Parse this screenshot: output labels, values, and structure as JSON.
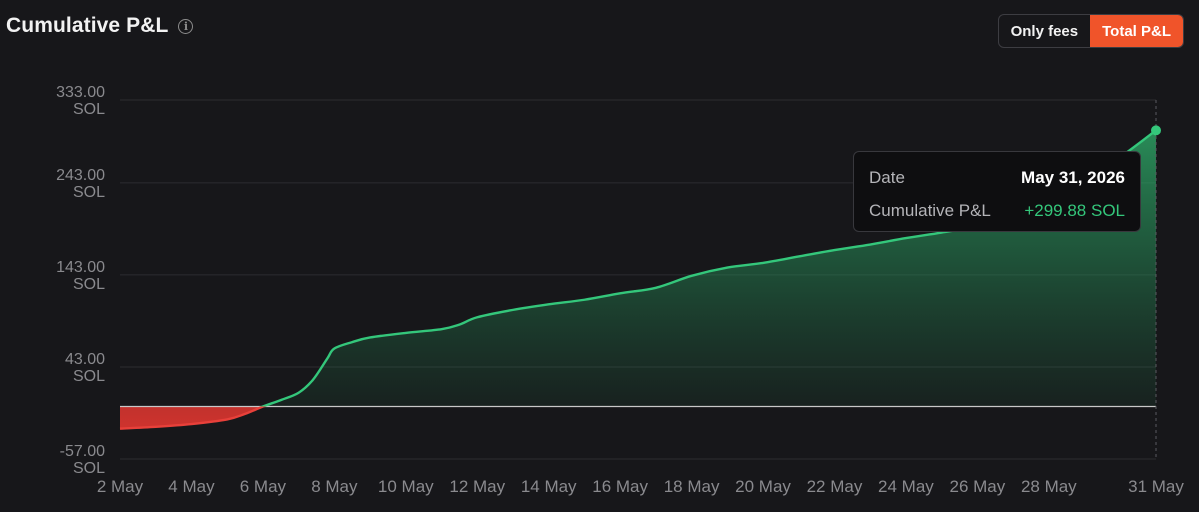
{
  "header": {
    "title": "Cumulative P&L",
    "info_icon": "info-circle-icon"
  },
  "toggle": {
    "options": [
      {
        "label": "Only fees",
        "active": false
      },
      {
        "label": "Total P&L",
        "active": true
      }
    ]
  },
  "tooltip": {
    "date_label": "Date",
    "date_value": "May 31, 2026",
    "pnl_label": "Cumulative P&L",
    "pnl_value": "+299.88 SOL"
  },
  "colors": {
    "positive": "#34c77b",
    "negative": "#e8403a",
    "accent": "#f0542a",
    "zero_line": "#c8c8c8"
  },
  "chart_data": {
    "type": "area",
    "ylim": [
      -57,
      333
    ],
    "y_ticks": [
      {
        "value": 333,
        "label": "333.00",
        "unit": "SOL"
      },
      {
        "value": 243,
        "label": "243.00",
        "unit": "SOL"
      },
      {
        "value": 143,
        "label": "143.00",
        "unit": "SOL"
      },
      {
        "value": 43,
        "label": "43.00",
        "unit": "SOL"
      },
      {
        "value": -57,
        "label": "-57.00",
        "unit": "SOL"
      }
    ],
    "x_ticks": [
      "2 May",
      "4 May",
      "6 May",
      "8 May",
      "10 May",
      "12 May",
      "14 May",
      "16 May",
      "18 May",
      "20 May",
      "22 May",
      "24 May",
      "26 May",
      "28 May",
      "31 May"
    ],
    "x_tick_days": [
      2,
      4,
      6,
      8,
      10,
      12,
      14,
      16,
      18,
      20,
      22,
      24,
      26,
      28,
      31
    ],
    "grid": true,
    "series": [
      {
        "x": [
          2,
          3,
          4,
          5,
          5.5,
          6,
          6.5,
          7,
          7.4,
          7.8,
          8,
          8.5,
          9,
          10,
          11,
          11.5,
          12,
          13,
          14,
          15,
          16,
          17,
          18,
          19,
          20,
          21,
          22,
          23,
          24,
          25,
          26,
          27,
          28,
          29,
          30,
          31
        ],
        "y": [
          -24,
          -22,
          -19,
          -14,
          -8,
          0,
          7,
          15,
          29,
          52,
          63,
          70,
          75,
          80,
          84,
          89,
          97,
          105,
          111,
          116,
          123,
          129,
          142,
          151,
          156,
          163,
          170,
          176,
          183,
          189,
          196,
          208,
          226,
          246,
          271,
          300
        ]
      }
    ]
  }
}
